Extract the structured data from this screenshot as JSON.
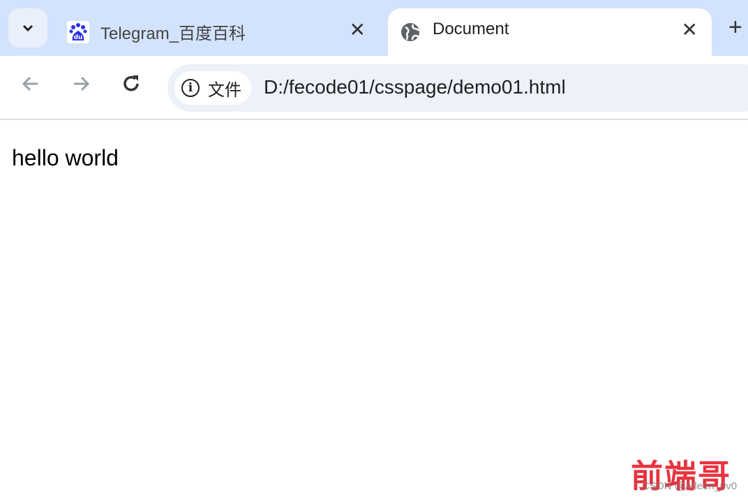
{
  "tabs": [
    {
      "title": "Telegram_百度百科",
      "icon": "baidu-paw-icon",
      "active": false
    },
    {
      "title": "Document",
      "icon": "globe-icon",
      "active": true
    }
  ],
  "toolbar": {
    "security_label": "文件",
    "url": "D:/fecode01/csspage/demo01.html"
  },
  "page": {
    "text": "hello world"
  },
  "watermark": {
    "logo": "前端哥",
    "credit": "CSDN @Aileen_0v0"
  },
  "colors": {
    "tabbar": "#d3e3fd",
    "omnibox": "#edf1f9",
    "baidu_blue": "#2932e1",
    "watermark_red": "#e8343f"
  }
}
